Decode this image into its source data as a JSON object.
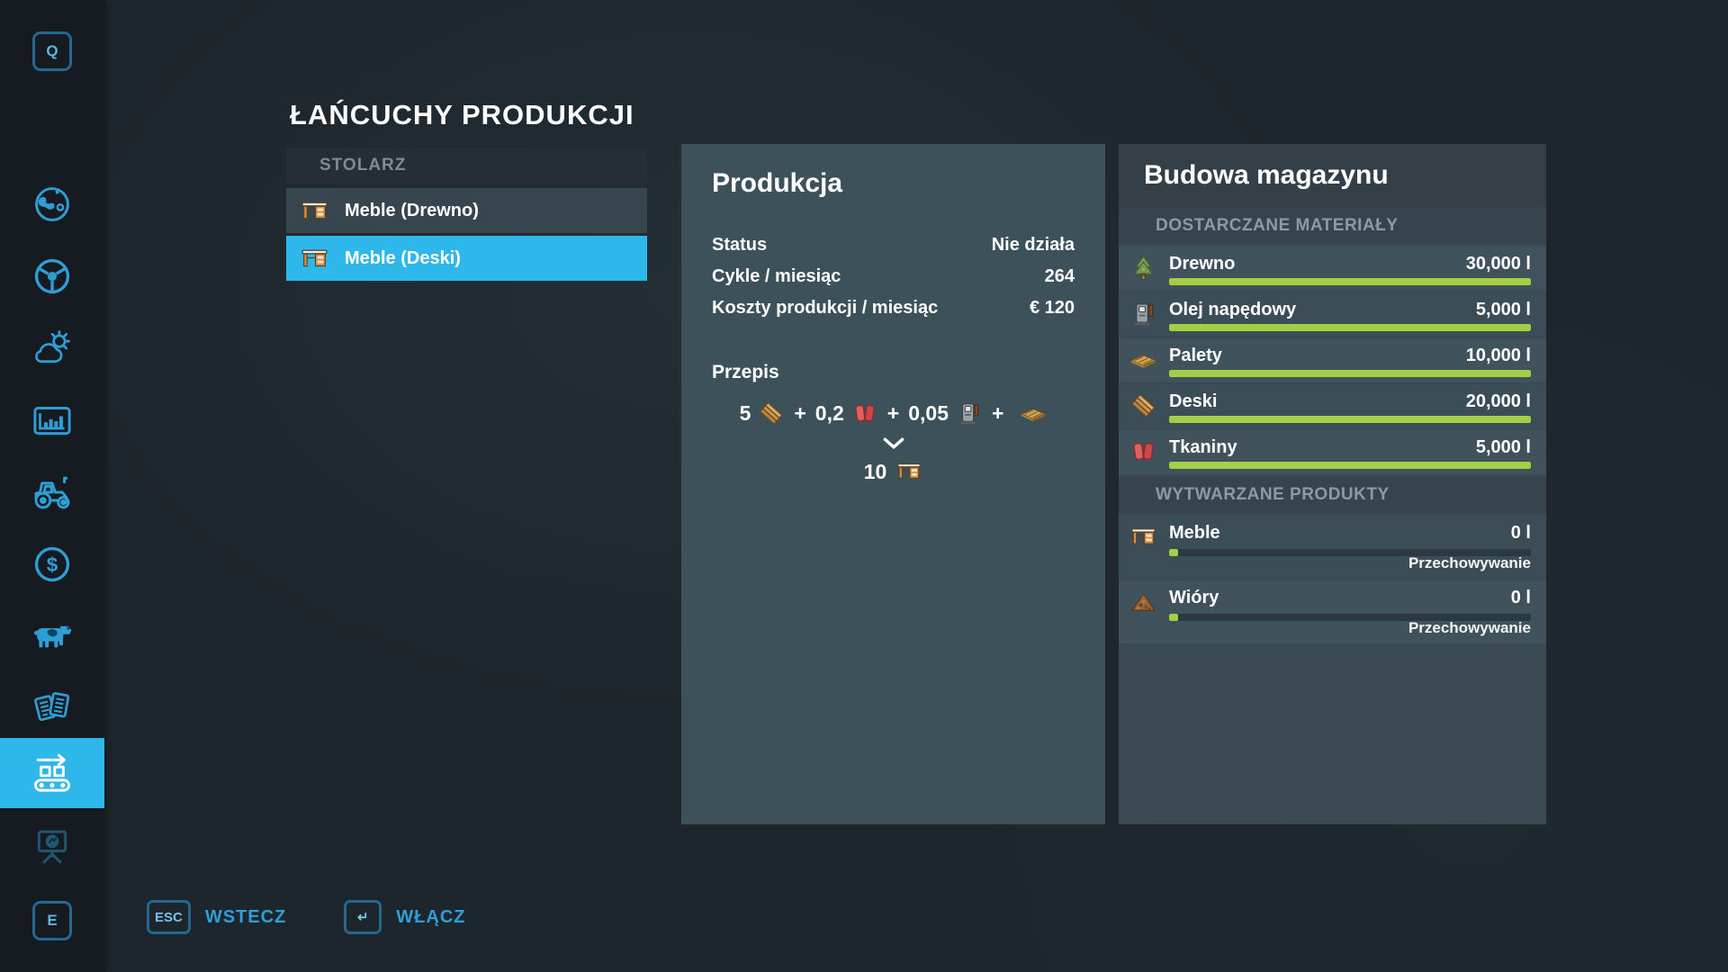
{
  "colors": {
    "accent_cyan": "#2eb7ea",
    "sidebar_icon_blue": "#2d9fd6",
    "progress_green": "#a3cf45",
    "panel_slate": "#3d515a"
  },
  "sidebar": {
    "top_key": "Q",
    "bottom_key": "E",
    "items": [
      {
        "id": "map",
        "icon": "globe-icon"
      },
      {
        "id": "garage",
        "icon": "steering-wheel-icon"
      },
      {
        "id": "weather",
        "icon": "weather-icon"
      },
      {
        "id": "statistics",
        "icon": "bar-chart-icon"
      },
      {
        "id": "vehicles",
        "icon": "tractor-icon"
      },
      {
        "id": "finances",
        "icon": "dollar-icon"
      },
      {
        "id": "animals",
        "icon": "cow-icon"
      },
      {
        "id": "contracts",
        "icon": "documents-icon"
      },
      {
        "id": "production-chains",
        "icon": "conveyor-icon",
        "selected": true
      },
      {
        "id": "help",
        "icon": "easel-icon",
        "dimmed": true
      }
    ]
  },
  "page": {
    "title": "ŁAŃCUCHY PRODUKCJI"
  },
  "chain_list": {
    "group_label": "STOLARZ",
    "items": [
      {
        "label": "Meble (Drewno)",
        "selected": false
      },
      {
        "label": "Meble (Deski)",
        "selected": true
      }
    ]
  },
  "production": {
    "title": "Produkcja",
    "stats": [
      {
        "label": "Status",
        "value": "Nie działa"
      },
      {
        "label": "Cykle / miesiąc",
        "value": "264"
      },
      {
        "label": "Koszty produkcji / miesiąc",
        "value": "€ 120"
      }
    ],
    "recipe": {
      "heading": "Przepis",
      "plus": "+",
      "inputs": [
        {
          "amount": "5",
          "icon": "boards-icon"
        },
        {
          "amount": "0,2",
          "icon": "fabric-icon"
        },
        {
          "amount": "0,05",
          "icon": "diesel-icon"
        },
        {
          "amount": "",
          "icon": "pallet-icon"
        }
      ],
      "output": {
        "amount": "10",
        "icon": "furniture-icon"
      }
    }
  },
  "storage": {
    "title": "Budowa magazynu",
    "materials_header": "DOSTARCZANE MATERIAŁY",
    "materials": [
      {
        "name": "Drewno",
        "value": "30,000 l",
        "icon": "tree-icon",
        "fill": 100
      },
      {
        "name": "Olej napędowy",
        "value": "5,000 l",
        "icon": "diesel-icon",
        "fill": 100
      },
      {
        "name": "Palety",
        "value": "10,000 l",
        "icon": "pallet-icon",
        "fill": 100
      },
      {
        "name": "Deski",
        "value": "20,000 l",
        "icon": "boards-icon",
        "fill": 100
      },
      {
        "name": "Tkaniny",
        "value": "5,000 l",
        "icon": "fabric-icon",
        "fill": 100
      }
    ],
    "products_header": "WYTWARZANE PRODUKTY",
    "products": [
      {
        "name": "Meble",
        "value": "0 l",
        "icon": "furniture-icon",
        "fill": 2.5,
        "note": "Przechowywanie"
      },
      {
        "name": "Wióry",
        "value": "0 l",
        "icon": "woodchips-icon",
        "fill": 2.5,
        "note": "Przechowywanie"
      }
    ]
  },
  "footer": {
    "back": {
      "key": "ESC",
      "label": "WSTECZ"
    },
    "activate": {
      "key": "↵",
      "label": "WŁĄCZ"
    }
  }
}
